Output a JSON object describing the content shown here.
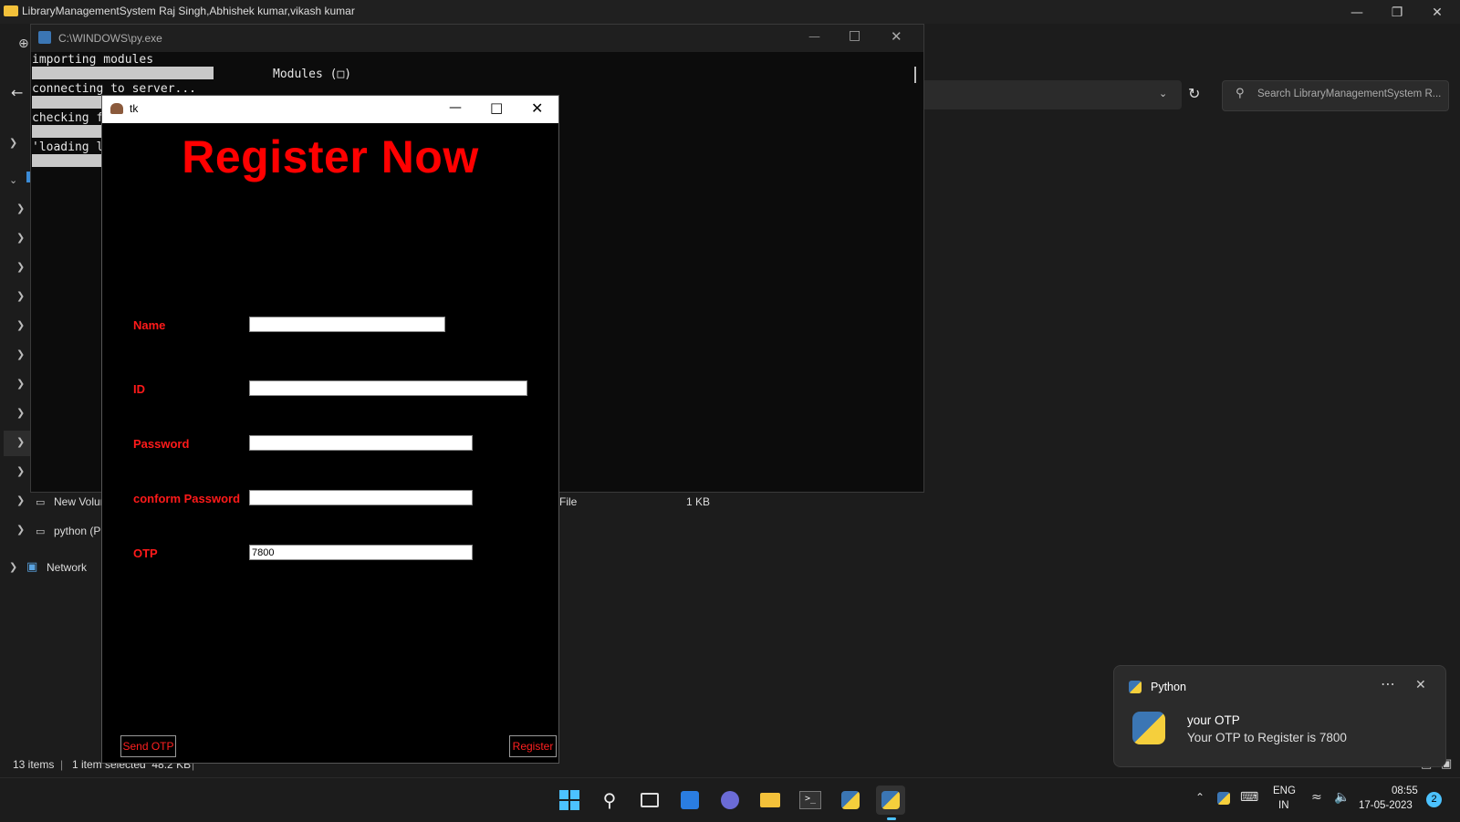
{
  "explorer": {
    "title": "LibraryManagementSystem Raj Singh,Abhishek kumar,vikash kumar",
    "search_placeholder": "Search LibraryManagementSystem R...",
    "nav_items": [
      "New Volun",
      "python (P",
      "Network"
    ],
    "file_row": {
      "type": "File",
      "size": "1 KB"
    },
    "status": {
      "items": "13 items",
      "selected": "1 item selected  48.2 KB"
    }
  },
  "console": {
    "title": "C:\\WINDOWS\\py.exe",
    "lines": [
      "importing modules",
      "connecting to server...",
      "checking f",
      "'loading li"
    ],
    "modules_text": "Modules (□)"
  },
  "tk_window": {
    "title": "tk",
    "heading": "Register Now",
    "fields": {
      "name_label": "Name",
      "id_label": "ID",
      "password_label": "Password",
      "confirm_label": "conform Password",
      "otp_label": "OTP",
      "otp_value": "7800"
    },
    "send_otp_label": "Send OTP",
    "register_label": "Register"
  },
  "toast": {
    "app": "Python",
    "title": "your OTP",
    "body": "Your OTP to Register is 7800"
  },
  "taskbar": {
    "lang": "ENG",
    "region": "IN",
    "time": "08:55",
    "date": "17-05-2023",
    "notification_count": "2"
  },
  "colors": {
    "accent_red": "#ff0000",
    "tk_bg": "#000000",
    "taskbar_bg": "#1c1c1c"
  }
}
